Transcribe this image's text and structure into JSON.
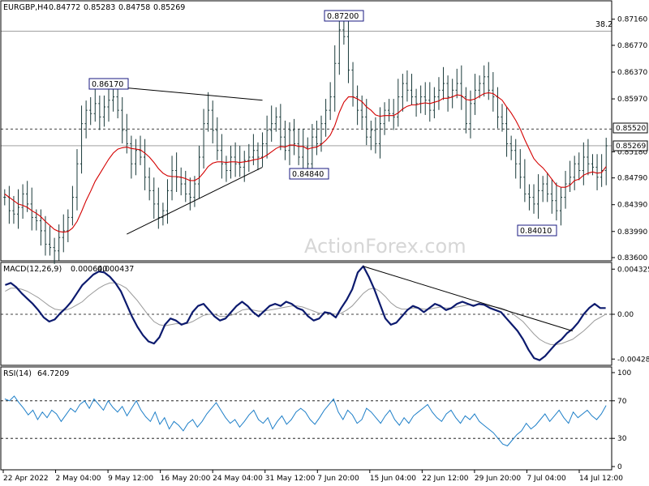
{
  "chart_data": [
    {
      "type": "ohlc",
      "panel": "price",
      "title": "EURGBP,H4",
      "ohlc_header": [
        "0.84772",
        "0.85283",
        "0.84758",
        "0.85269"
      ],
      "ylim": [
        0.836,
        0.8735
      ],
      "y_ticks": [
        "0.87160",
        "0.86770",
        "0.86370",
        "0.85970",
        "0.85180",
        "0.84790",
        "0.84390",
        "0.83990",
        "0.83600"
      ],
      "x_ticks": [
        "22 Apr 2022",
        "2 May 04:00",
        "9 May 12:00",
        "16 May 20:00",
        "24 May 04:00",
        "31 May 12:00",
        "7 Jun 20:00",
        "15 Jun 04:00",
        "22 Jun 12:00",
        "29 Jun 20:00",
        "7 Jul 04:00",
        "14 Jul 12:00"
      ],
      "current_price_label": "0.85269",
      "level_label": "0.85520",
      "fib_label": "38.2",
      "callouts": [
        "0.86170",
        "0.84840",
        "0.87200",
        "0.84010"
      ],
      "watermark": "ActionForex.com",
      "moving_average": "red",
      "series": [
        {
          "name": "price",
          "values": [
            0.845,
            0.843,
            0.8425,
            0.8435,
            0.8455,
            0.844,
            0.842,
            0.8415,
            0.84,
            0.838,
            0.8375,
            0.837,
            0.839,
            0.84,
            0.842,
            0.845,
            0.85,
            0.856,
            0.858,
            0.8575,
            0.859,
            0.857,
            0.8585,
            0.8595,
            0.86,
            0.858,
            0.855,
            0.853,
            0.85,
            0.852,
            0.851,
            0.848,
            0.846,
            0.844,
            0.842,
            0.843,
            0.846,
            0.849,
            0.848,
            0.847,
            0.8455,
            0.845,
            0.847,
            0.851,
            0.856,
            0.858,
            0.855,
            0.852,
            0.85,
            0.849,
            0.851,
            0.85,
            0.8495,
            0.8505,
            0.851,
            0.852,
            0.851,
            0.853,
            0.855,
            0.856,
            0.857,
            0.854,
            0.852,
            0.855,
            0.853,
            0.851,
            0.8525,
            0.85,
            0.854,
            0.853,
            0.856,
            0.858,
            0.86,
            0.865,
            0.87,
            0.869,
            0.864,
            0.86,
            0.858,
            0.857,
            0.854,
            0.855,
            0.853,
            0.856,
            0.858,
            0.8575,
            0.857,
            0.86,
            0.862,
            0.861,
            0.86,
            0.859,
            0.86,
            0.8595,
            0.858,
            0.86,
            0.861,
            0.862,
            0.86,
            0.861,
            0.862,
            0.86,
            0.856,
            0.859,
            0.861,
            0.862,
            0.863,
            0.861,
            0.86,
            0.857,
            0.856,
            0.853,
            0.852,
            0.85,
            0.848,
            0.8455,
            0.845,
            0.844,
            0.846,
            0.847,
            0.8455,
            0.8445,
            0.843,
            0.845,
            0.847,
            0.848,
            0.85,
            0.849,
            0.851,
            0.85,
            0.8495,
            0.848,
            0.849,
            0.8527
          ]
        },
        {
          "name": "ma",
          "values": [
            0.8455,
            0.845,
            0.8445,
            0.844,
            0.8438,
            0.8435,
            0.843,
            0.8426,
            0.8421,
            0.8414,
            0.8408,
            0.8402,
            0.8399,
            0.8398,
            0.8399,
            0.8404,
            0.8414,
            0.8429,
            0.8445,
            0.8459,
            0.8474,
            0.8485,
            0.8496,
            0.8507,
            0.8516,
            0.8522,
            0.8524,
            0.8525,
            0.8523,
            0.8522,
            0.8521,
            0.8516,
            0.851,
            0.8502,
            0.8493,
            0.8486,
            0.8482,
            0.8481,
            0.8481,
            0.848,
            0.8478,
            0.8475,
            0.8475,
            0.8479,
            0.8487,
            0.8496,
            0.8501,
            0.8503,
            0.8503,
            0.8502,
            0.8503,
            0.8503,
            0.8502,
            0.8503,
            0.8504,
            0.8506,
            0.8507,
            0.8509,
            0.8513,
            0.8518,
            0.8523,
            0.8526,
            0.8525,
            0.8528,
            0.8528,
            0.8526,
            0.8526,
            0.8522,
            0.8524,
            0.8525,
            0.8529,
            0.8535,
            0.8543,
            0.8557,
            0.8577,
            0.8592,
            0.86,
            0.86,
            0.8597,
            0.8593,
            0.8585,
            0.858,
            0.8573,
            0.8571,
            0.8572,
            0.8572,
            0.8572,
            0.8576,
            0.8582,
            0.8586,
            0.8588,
            0.8588,
            0.859,
            0.8591,
            0.859,
            0.8592,
            0.8594,
            0.8598,
            0.8598,
            0.86,
            0.8603,
            0.8602,
            0.8596,
            0.8595,
            0.8597,
            0.8601,
            0.8605,
            0.8606,
            0.8605,
            0.86,
            0.8595,
            0.8585,
            0.8576,
            0.8565,
            0.8552,
            0.8536,
            0.8522,
            0.8508,
            0.85,
            0.8494,
            0.8486,
            0.8477,
            0.8468,
            0.8465,
            0.8465,
            0.8468,
            0.8475,
            0.8477,
            0.8483,
            0.8486,
            0.8488,
            0.8486,
            0.8487,
            0.8496
          ]
        }
      ],
      "annotations": [
        {
          "type": "trendline",
          "from": [
            21,
            0.8617
          ],
          "to": [
            57,
            0.8595
          ]
        },
        {
          "type": "trendline",
          "from": [
            27,
            0.8395
          ],
          "to": [
            57,
            0.8495
          ]
        },
        {
          "type": "hline",
          "y": 0.8698
        },
        {
          "type": "hline",
          "y": 0.8552,
          "dashed": true
        },
        {
          "type": "hline",
          "y": 0.8527
        }
      ]
    },
    {
      "type": "line",
      "panel": "macd",
      "title": "MACD(12,26,9)",
      "header_values": [
        "0.000640",
        "0.000437"
      ],
      "ylim": [
        -0.0045,
        0.0045
      ],
      "y_ticks": [
        "0.004325",
        "0.00",
        "-0.004288"
      ],
      "series": [
        {
          "name": "MACD",
          "values": [
            0.0028,
            0.003,
            0.0026,
            0.002,
            0.0015,
            0.001,
            0.0004,
            -0.0003,
            -0.0007,
            -0.0005,
            0.0001,
            0.0006,
            0.0012,
            0.002,
            0.0028,
            0.0033,
            0.0038,
            0.0041,
            0.004,
            0.0036,
            0.003,
            0.0022,
            0.001,
            -0.0002,
            -0.0012,
            -0.002,
            -0.0026,
            -0.0028,
            -0.0022,
            -0.001,
            -0.0004,
            -0.0006,
            -0.001,
            -0.0008,
            0.0002,
            0.0008,
            0.001,
            0.0004,
            -0.0002,
            -0.0006,
            -0.0004,
            0.0002,
            0.0008,
            0.0012,
            0.0008,
            0.0002,
            -0.0002,
            0.0003,
            0.0008,
            0.001,
            0.0008,
            0.0012,
            0.001,
            0.0006,
            0.0004,
            -0.0002,
            -0.0006,
            -0.0004,
            0.0002,
            0.0001,
            -0.0003,
            0.0006,
            0.0014,
            0.0024,
            0.004,
            0.0046,
            0.0036,
            0.0024,
            0.001,
            -0.0004,
            -0.001,
            -0.0008,
            -0.0002,
            0.0004,
            0.0008,
            0.0006,
            0.0002,
            0.0006,
            0.001,
            0.0008,
            0.0004,
            0.0006,
            0.001,
            0.0012,
            0.001,
            0.0008,
            0.001,
            0.0009,
            0.0006,
            0.0004,
            0.0002,
            -0.0004,
            -0.001,
            -0.0016,
            -0.0024,
            -0.0034,
            -0.0042,
            -0.0044,
            -0.004,
            -0.0034,
            -0.0028,
            -0.0024,
            -0.0018,
            -0.0014,
            -0.0008,
            0.0,
            0.0006,
            0.001,
            0.0006,
            0.0006
          ]
        },
        {
          "name": "Signal",
          "values": [
            0.0022,
            0.0025,
            0.0025,
            0.0024,
            0.0022,
            0.0019,
            0.0016,
            0.0012,
            0.0008,
            0.0005,
            0.0004,
            0.0004,
            0.0006,
            0.0009,
            0.0012,
            0.0017,
            0.0021,
            0.0025,
            0.0028,
            0.003,
            0.003,
            0.0028,
            0.0025,
            0.0019,
            0.0013,
            0.0006,
            -0.0001,
            -0.0007,
            -0.001,
            -0.0011,
            -0.001,
            -0.0009,
            -0.0009,
            -0.0009,
            -0.0007,
            -0.0004,
            -0.0001,
            0.0,
            0.0,
            -0.0002,
            -0.0002,
            -0.0001,
            0.0001,
            0.0004,
            0.0005,
            0.0004,
            0.0003,
            0.0003,
            0.0004,
            0.0005,
            0.0006,
            0.0007,
            0.0008,
            0.0008,
            0.0007,
            0.0005,
            0.0003,
            0.0001,
            0.0001,
            0.0001,
            0.0,
            0.0001,
            0.0004,
            0.0008,
            0.0014,
            0.002,
            0.0024,
            0.0025,
            0.0022,
            0.0017,
            0.0011,
            0.0007,
            0.0005,
            0.0005,
            0.0006,
            0.0006,
            0.0005,
            0.0005,
            0.0006,
            0.0007,
            0.0006,
            0.0006,
            0.0007,
            0.0008,
            0.0009,
            0.0009,
            0.0009,
            0.0009,
            0.0008,
            0.0007,
            0.0006,
            0.0004,
            0.0001,
            -0.0003,
            -0.0007,
            -0.0013,
            -0.0019,
            -0.0024,
            -0.0027,
            -0.0029,
            -0.0029,
            -0.0028,
            -0.0026,
            -0.0024,
            -0.002,
            -0.0016,
            -0.0011,
            -0.0006,
            -0.0003,
            0.0
          ]
        }
      ],
      "annotations": [
        {
          "type": "trendline",
          "from": [
            65,
            0.0046
          ],
          "to": [
            103,
            -0.0016
          ]
        }
      ]
    },
    {
      "type": "line",
      "panel": "rsi",
      "title": "RSI(14)",
      "header_values": [
        "64.7209"
      ],
      "ylim": [
        0,
        100
      ],
      "y_ticks": [
        "100",
        "70",
        "30",
        "0"
      ],
      "series": [
        {
          "name": "RSI",
          "values": [
            72,
            70,
            75,
            68,
            62,
            55,
            60,
            50,
            58,
            52,
            60,
            56,
            48,
            55,
            62,
            58,
            66,
            70,
            62,
            72,
            66,
            60,
            70,
            63,
            58,
            64,
            54,
            62,
            70,
            60,
            53,
            48,
            58,
            45,
            52,
            40,
            48,
            44,
            38,
            46,
            50,
            42,
            48,
            56,
            62,
            68,
            60,
            52,
            46,
            50,
            42,
            48,
            55,
            60,
            50,
            46,
            52,
            40,
            48,
            54,
            45,
            50,
            58,
            62,
            58,
            50,
            45,
            52,
            60,
            66,
            72,
            58,
            50,
            60,
            55,
            46,
            50,
            62,
            58,
            52,
            46,
            54,
            60,
            50,
            44,
            52,
            46,
            54,
            58,
            62,
            66,
            58,
            52,
            48,
            56,
            60,
            52,
            46,
            54,
            50,
            56,
            48,
            44,
            40,
            36,
            30,
            24,
            22,
            28,
            34,
            38,
            46,
            40,
            44,
            50,
            56,
            48,
            54,
            60,
            52,
            46,
            58,
            52,
            56,
            60,
            54,
            50,
            56,
            65
          ]
        }
      ],
      "annotations": [
        {
          "type": "hline",
          "y": 70,
          "dashed": true
        },
        {
          "type": "hline",
          "y": 30,
          "dashed": true
        }
      ]
    }
  ]
}
